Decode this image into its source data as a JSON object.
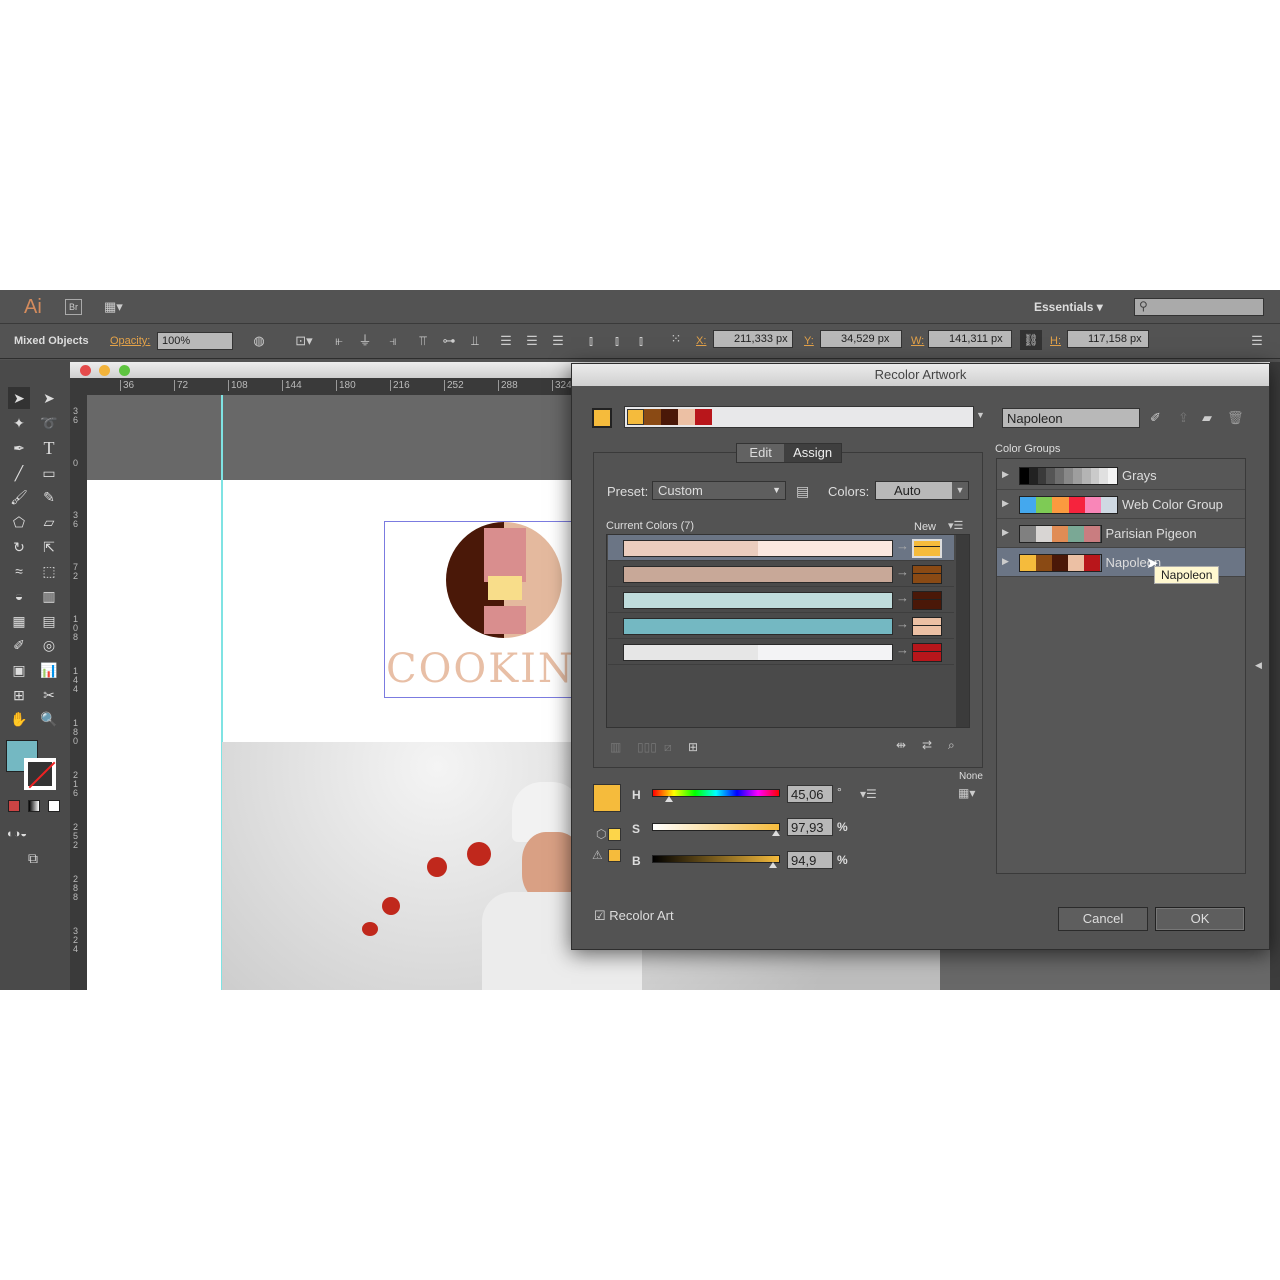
{
  "app": {
    "logo": "Ai",
    "bridge": "Br",
    "workspace": "Essentials",
    "search_placeholder": ""
  },
  "control_bar": {
    "selection": "Mixed Objects",
    "opacity_label": "Opacity:",
    "opacity": "100%",
    "x_label": "X:",
    "x": "211,333 px",
    "y_label": "Y:",
    "y": "34,529 px",
    "w_label": "W:",
    "w": "141,311 px",
    "h_label": "H:",
    "h": "117,158 px"
  },
  "ruler": {
    "h_ticks": [
      "36",
      "72",
      "108",
      "144",
      "180",
      "216",
      "252",
      "288",
      "324"
    ],
    "v_ticks": [
      "36",
      "0",
      "36",
      "72",
      "108",
      "144",
      "180",
      "216",
      "252",
      "288",
      "324"
    ]
  },
  "artwork": {
    "logo_text": "COOKIN"
  },
  "dialog": {
    "title": "Recolor Artwork",
    "group_name": "Napoleon",
    "active_colors": [
      "#f5bb3c",
      "#8a4a14",
      "#4a1808",
      "#ecc0a4",
      "#b8161b"
    ],
    "tabs": [
      {
        "label": "Edit",
        "active": false
      },
      {
        "label": "Assign",
        "active": true
      }
    ],
    "preset_label": "Preset:",
    "preset": "Custom",
    "colors_label": "Colors:",
    "colors": "Auto",
    "current_colors_label": "Current Colors (7)",
    "new_label": "New",
    "rows": [
      {
        "current": [
          "#ebcdbe",
          "#fbe8e0"
        ],
        "new": [
          "#f5bb3c",
          "#f5bb3c"
        ],
        "selected": true
      },
      {
        "current": [
          "#c8a898",
          "#c8a898"
        ],
        "new": [
          "#8a4a14",
          "#8a4a14"
        ],
        "selected": false
      },
      {
        "current": [
          "#bfdcdc",
          "#bfdcdc"
        ],
        "new": [
          "#4a1808",
          "#4a1808"
        ],
        "selected": false
      },
      {
        "current": [
          "#74b8c2",
          "#74b8c2"
        ],
        "new": [
          "#ecc0a4",
          "#ecc0a4"
        ],
        "selected": false
      },
      {
        "current": [
          "#e6e6e6",
          "#f3f3f5"
        ],
        "new": [
          "#b8161b",
          "#b8161b"
        ],
        "selected": false
      }
    ],
    "hsb": {
      "swatch": "#f5bb3c",
      "h_label": "H",
      "h": "45,06",
      "h_unit": "°",
      "h_fraction": 0.125,
      "s_label": "S",
      "s": "97,93",
      "s_unit": "%",
      "s_fraction": 0.979,
      "b_label": "B",
      "b": "94,9",
      "b_unit": "%",
      "b_fraction": 0.949
    },
    "none_label": "None",
    "recolor_art_label": "Recolor Art",
    "recolor_art_checked": true,
    "cancel_label": "Cancel",
    "ok_label": "OK",
    "color_groups_label": "Color Groups",
    "groups": [
      {
        "name": "Grays",
        "colors": [
          "#000",
          "#222",
          "#3a3a3a",
          "#555",
          "#6e6e6e",
          "#888",
          "#9e9e9e",
          "#b4b4b4",
          "#cacaca",
          "#e0e0e0",
          "#f4f4f4"
        ]
      },
      {
        "name": "Web Color Group",
        "colors": [
          "#44a8ee",
          "#7ecb55",
          "#fb9a3f",
          "#f6233d",
          "#f986b8",
          "#cfd9e3"
        ]
      },
      {
        "name": "Parisian Pigeon",
        "colors": [
          "#808080",
          "#d8d5d3",
          "#e08c55",
          "#7aa895",
          "#c97d80"
        ]
      },
      {
        "name": "Napoleon",
        "colors": [
          "#f5bb3c",
          "#8a4a14",
          "#4a1808",
          "#ecc0a4",
          "#b8161b"
        ],
        "selected": true
      }
    ],
    "tooltip": "Napoleon"
  }
}
